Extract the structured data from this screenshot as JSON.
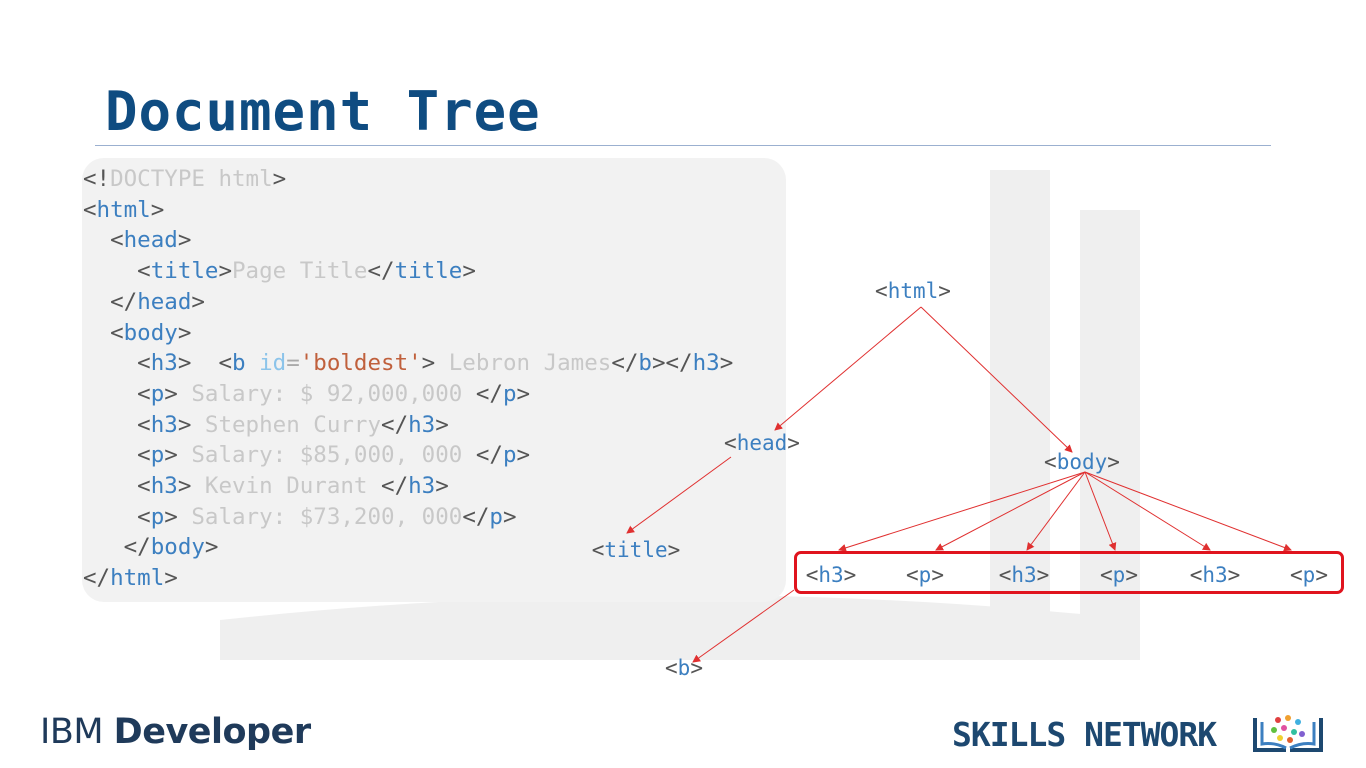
{
  "slide": {
    "title": "Document Tree"
  },
  "code_lines": [
    [
      {
        "t": "<!",
        "c": "br"
      },
      {
        "t": "DOCTYPE html",
        "c": "txt"
      },
      {
        "t": ">",
        "c": "br"
      }
    ],
    [
      {
        "t": "<",
        "c": "br"
      },
      {
        "t": "html",
        "c": "tag"
      },
      {
        "t": ">",
        "c": "br"
      }
    ],
    [
      {
        "t": "  <",
        "c": "br"
      },
      {
        "t": "head",
        "c": "tag"
      },
      {
        "t": ">",
        "c": "br"
      }
    ],
    [
      {
        "t": "    <",
        "c": "br"
      },
      {
        "t": "title",
        "c": "tag"
      },
      {
        "t": ">",
        "c": "br"
      },
      {
        "t": "Page Title",
        "c": "txt"
      },
      {
        "t": "</",
        "c": "br"
      },
      {
        "t": "title",
        "c": "tag"
      },
      {
        "t": ">",
        "c": "br"
      }
    ],
    [
      {
        "t": "  </",
        "c": "br"
      },
      {
        "t": "head",
        "c": "tag"
      },
      {
        "t": ">",
        "c": "br"
      }
    ],
    [
      {
        "t": "  <",
        "c": "br"
      },
      {
        "t": "body",
        "c": "tag"
      },
      {
        "t": ">",
        "c": "br"
      }
    ],
    [
      {
        "t": "    <",
        "c": "br"
      },
      {
        "t": "h3",
        "c": "tag"
      },
      {
        "t": ">  <",
        "c": "br"
      },
      {
        "t": "b",
        "c": "tag"
      },
      {
        "t": " ",
        "c": "br"
      },
      {
        "t": "id",
        "c": "attr"
      },
      {
        "t": "=",
        "c": "eq"
      },
      {
        "t": "'boldest'",
        "c": "val"
      },
      {
        "t": "> ",
        "c": "br"
      },
      {
        "t": "Lebron James",
        "c": "txt"
      },
      {
        "t": "</",
        "c": "br"
      },
      {
        "t": "b",
        "c": "tag"
      },
      {
        "t": "></",
        "c": "br"
      },
      {
        "t": "h3",
        "c": "tag"
      },
      {
        "t": ">",
        "c": "br"
      }
    ],
    [
      {
        "t": "    <",
        "c": "br"
      },
      {
        "t": "p",
        "c": "tag"
      },
      {
        "t": "> ",
        "c": "br"
      },
      {
        "t": "Salary: $ 92,000,000 ",
        "c": "txt"
      },
      {
        "t": "</",
        "c": "br"
      },
      {
        "t": "p",
        "c": "tag"
      },
      {
        "t": ">",
        "c": "br"
      }
    ],
    [
      {
        "t": "    <",
        "c": "br"
      },
      {
        "t": "h3",
        "c": "tag"
      },
      {
        "t": "> ",
        "c": "br"
      },
      {
        "t": "Stephen Curry",
        "c": "txt"
      },
      {
        "t": "</",
        "c": "br"
      },
      {
        "t": "h3",
        "c": "tag"
      },
      {
        "t": ">",
        "c": "br"
      }
    ],
    [
      {
        "t": "    <",
        "c": "br"
      },
      {
        "t": "p",
        "c": "tag"
      },
      {
        "t": "> ",
        "c": "br"
      },
      {
        "t": "Salary: $85,000, 000 ",
        "c": "txt"
      },
      {
        "t": "</",
        "c": "br"
      },
      {
        "t": "p",
        "c": "tag"
      },
      {
        "t": ">",
        "c": "br"
      }
    ],
    [
      {
        "t": "    <",
        "c": "br"
      },
      {
        "t": "h3",
        "c": "tag"
      },
      {
        "t": "> ",
        "c": "br"
      },
      {
        "t": "Kevin Durant ",
        "c": "txt"
      },
      {
        "t": "</",
        "c": "br"
      },
      {
        "t": "h3",
        "c": "tag"
      },
      {
        "t": ">",
        "c": "br"
      }
    ],
    [
      {
        "t": "    <",
        "c": "br"
      },
      {
        "t": "p",
        "c": "tag"
      },
      {
        "t": "> ",
        "c": "br"
      },
      {
        "t": "Salary: $73,200, 000",
        "c": "txt"
      },
      {
        "t": "</",
        "c": "br"
      },
      {
        "t": "p",
        "c": "tag"
      },
      {
        "t": ">",
        "c": "br"
      }
    ],
    [
      {
        "t": "   </",
        "c": "br"
      },
      {
        "t": "body",
        "c": "tag"
      },
      {
        "t": ">",
        "c": "br"
      }
    ],
    [
      {
        "t": "</",
        "c": "br"
      },
      {
        "t": "html",
        "c": "tag"
      },
      {
        "t": ">",
        "c": "br"
      }
    ]
  ],
  "tree": {
    "html": "html",
    "head": "head",
    "body": "body",
    "title": "title",
    "b": "b",
    "body_children": [
      "h3",
      "p",
      "h3",
      "p",
      "h3",
      "p"
    ],
    "highlight_color": "#e0141e",
    "edge_color": "#e03030"
  },
  "footer": {
    "ibm_light": "IBM",
    "ibm_bold": "Developer",
    "skills_network": "SKILLS NETWORK"
  }
}
